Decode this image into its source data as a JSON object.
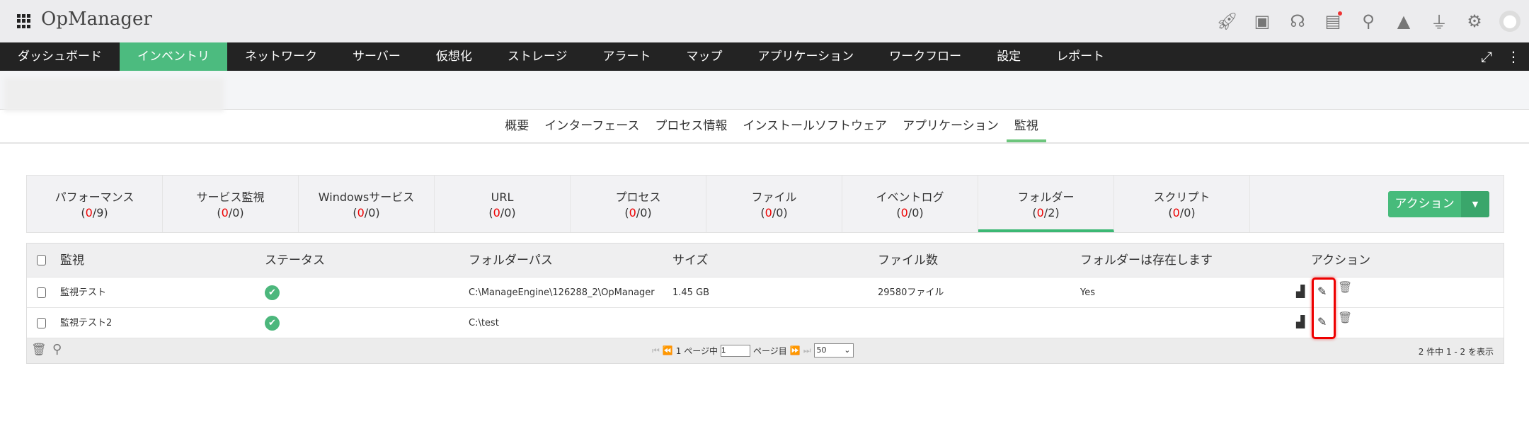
{
  "app": {
    "title": "OpManager",
    "header_icons": [
      "rocket-icon",
      "presentation-icon",
      "headset-icon",
      "gift-icon",
      "search-icon",
      "bell-icon",
      "plug-icon",
      "gear-icon",
      "user-avatar-icon"
    ]
  },
  "nav": [
    "ダッシュボード",
    "インベントリ",
    "ネットワーク",
    "サーバー",
    "仮想化",
    "ストレージ",
    "アラート",
    "マップ",
    "アプリケーション",
    "ワークフロー",
    "設定",
    "レポート"
  ],
  "subtabs": [
    "概要",
    "インターフェース",
    "プロセス情報",
    "インストールソフトウェア",
    "アプリケーション",
    "監視"
  ],
  "monitor_tabs": [
    {
      "label": "パフォーマンス",
      "down": "0",
      "total": "9"
    },
    {
      "label": "サービス監視",
      "down": "0",
      "total": "0"
    },
    {
      "label": "Windowsサービス",
      "down": "0",
      "total": "0"
    },
    {
      "label": "URL",
      "down": "0",
      "total": "0"
    },
    {
      "label": "プロセス",
      "down": "0",
      "total": "0"
    },
    {
      "label": "ファイル",
      "down": "0",
      "total": "0"
    },
    {
      "label": "イベントログ",
      "down": "0",
      "total": "0"
    },
    {
      "label": "フォルダー",
      "down": "0",
      "total": "2"
    },
    {
      "label": "スクリプト",
      "down": "0",
      "total": "0"
    }
  ],
  "action_button": "アクション",
  "table": {
    "headers": [
      "監視",
      "ステータス",
      "フォルダーパス",
      "サイズ",
      "ファイル数",
      "フォルダーは存在します",
      "アクション"
    ],
    "rows": [
      {
        "name": "監視テスト",
        "status": "ok",
        "path": "C:\\ManageEngine\\126288_2\\OpManager",
        "size": "1.45 GB",
        "files": "29580ファイル",
        "exists": "Yes"
      },
      {
        "name": "監視テスト2",
        "status": "ok",
        "path": "C:\\test",
        "size": "",
        "files": "",
        "exists": ""
      }
    ]
  },
  "pager": {
    "prefix": "1 ページ中",
    "page": "1",
    "suffix": "ページ目",
    "per_page": "50",
    "summary": "2 件中 1 - 2 を表示"
  }
}
